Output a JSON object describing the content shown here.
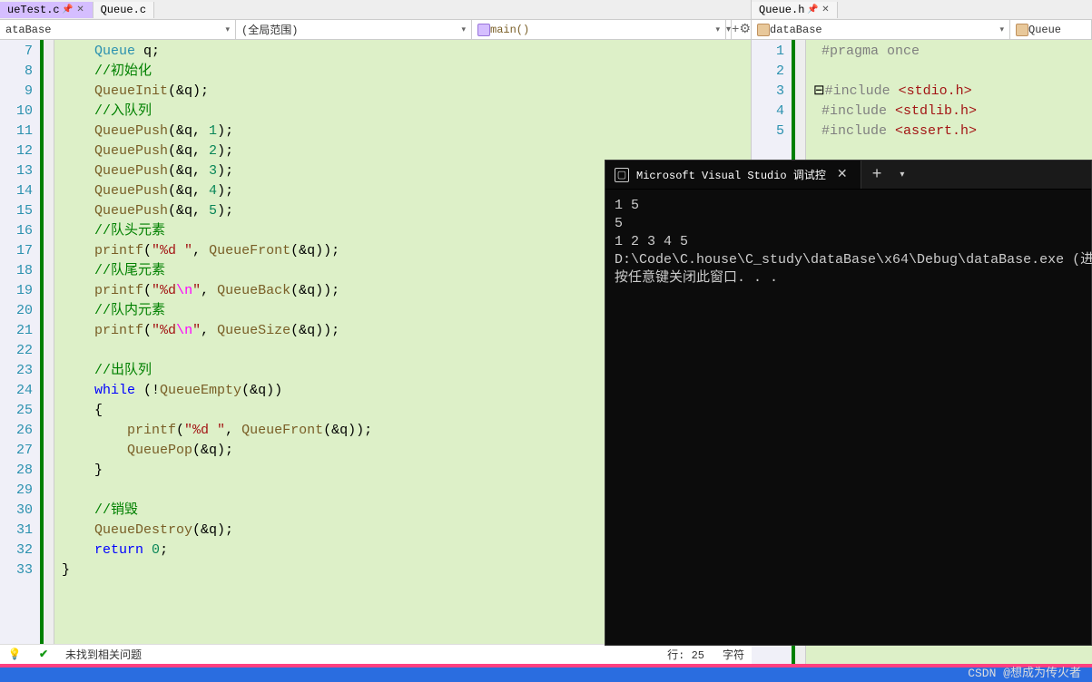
{
  "left": {
    "tabs": [
      {
        "label": "ueTest.c",
        "active": true
      },
      {
        "label": "Queue.c",
        "active": false
      }
    ],
    "scopes": {
      "project": "ataBase",
      "scope": "(全局范围)",
      "fn": "main()"
    },
    "lines": [
      {
        "n": 7,
        "html": "<span class='typ'>Queue</span> q;"
      },
      {
        "n": 8,
        "html": "<span class='com'>//初始化</span>"
      },
      {
        "n": 9,
        "html": "<span class='fn'>QueueInit</span>(&amp;q);"
      },
      {
        "n": 10,
        "html": "<span class='com'>//入队列</span>"
      },
      {
        "n": 11,
        "html": "<span class='fn'>QueuePush</span>(&amp;q, <span class='num'>1</span>);"
      },
      {
        "n": 12,
        "html": "<span class='fn'>QueuePush</span>(&amp;q, <span class='num'>2</span>);"
      },
      {
        "n": 13,
        "html": "<span class='fn'>QueuePush</span>(&amp;q, <span class='num'>3</span>);"
      },
      {
        "n": 14,
        "html": "<span class='fn'>QueuePush</span>(&amp;q, <span class='num'>4</span>);"
      },
      {
        "n": 15,
        "html": "<span class='fn'>QueuePush</span>(&amp;q, <span class='num'>5</span>);"
      },
      {
        "n": 16,
        "html": "<span class='com'>//队头元素</span>"
      },
      {
        "n": 17,
        "html": "<span class='fn'>printf</span>(<span class='str'>\"%d \"</span>, <span class='fn'>QueueFront</span>(&amp;q));"
      },
      {
        "n": 18,
        "html": "<span class='com'>//队尾元素</span>"
      },
      {
        "n": 19,
        "html": "<span class='fn'>printf</span>(<span class='str'>\"%d</span><span class='esc'>\\n</span><span class='str'>\"</span>, <span class='fn'>QueueBack</span>(&amp;q));"
      },
      {
        "n": 20,
        "html": "<span class='com'>//队内元素</span>"
      },
      {
        "n": 21,
        "html": "<span class='fn'>printf</span>(<span class='str'>\"%d</span><span class='esc'>\\n</span><span class='str'>\"</span>, <span class='fn'>QueueSize</span>(&amp;q));"
      },
      {
        "n": 22,
        "html": ""
      },
      {
        "n": 23,
        "html": "<span class='com'>//出队列</span>"
      },
      {
        "n": 24,
        "html": "<span class='kw'>while</span> (!<span class='fn'>QueueEmpty</span>(&amp;q))"
      },
      {
        "n": 25,
        "html": "{"
      },
      {
        "n": 26,
        "html": "    <span class='fn'>printf</span>(<span class='str'>\"%d \"</span>, <span class='fn'>QueueFront</span>(&amp;q));"
      },
      {
        "n": 27,
        "html": "    <span class='fn'>QueuePop</span>(&amp;q);"
      },
      {
        "n": 28,
        "html": "}"
      },
      {
        "n": 29,
        "html": ""
      },
      {
        "n": 30,
        "html": "<span class='com'>//销毁</span>"
      },
      {
        "n": 31,
        "html": "<span class='fn'>QueueDestroy</span>(&amp;q);"
      },
      {
        "n": 32,
        "html": "<span class='kw'>return</span> <span class='num'>0</span>;"
      },
      {
        "n": 33,
        "html": "",
        "pre": "}"
      }
    ],
    "status": {
      "issues": "未找到相关问题",
      "line": "行: 25",
      "char": "字符"
    }
  },
  "right": {
    "tabs": [
      {
        "label": "Queue.h"
      }
    ],
    "scopes": {
      "project": "dataBase",
      "struct": "Queue"
    },
    "lines": [
      {
        "n": 1,
        "html": "<span class='pre'>#pragma</span> <span class='pre'>once</span>"
      },
      {
        "n": 2,
        "html": ""
      },
      {
        "n": 3,
        "html": "<span class='pre'>#include</span> <span class='str'>&lt;stdio.h&gt;</span>",
        "fold": true
      },
      {
        "n": 4,
        "html": "<span class='pre'>#include</span> <span class='str'>&lt;stdlib.h&gt;</span>"
      },
      {
        "n": 5,
        "html": "<span class='pre'>#include</span> <span class='str'>&lt;assert.h&gt;</span>"
      }
    ]
  },
  "terminal": {
    "title": "Microsoft Visual Studio 调试控",
    "lines": [
      "1 5",
      "5",
      "1 2 3 4 5",
      "D:\\Code\\C.house\\C_study\\dataBase\\x64\\Debug\\dataBase.exe (进",
      "按任意键关闭此窗口. . ."
    ]
  },
  "watermark": "CSDN @想成为传火者"
}
